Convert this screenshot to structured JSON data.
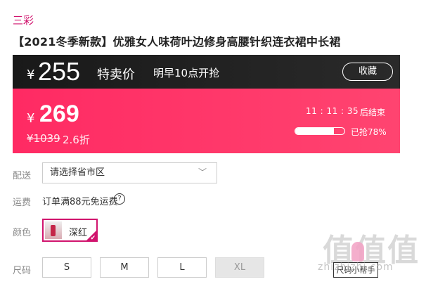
{
  "brand": "三彩",
  "product": {
    "title": "【2021冬季新款】优雅女人味荷叶边修身高腰针织连衣裙中长裙"
  },
  "promo": {
    "currency": "¥",
    "price": "255",
    "label": "特卖价",
    "start_text": "明早10点开抢",
    "favorite_label": "收藏"
  },
  "current": {
    "currency": "¥",
    "price": "269",
    "original": "¥1039",
    "discount": "2.6折",
    "countdown": "11 : 11 : 35",
    "countdown_suffix": "后结束",
    "sold_progress": 0.78,
    "sold_text": "已抢78%"
  },
  "delivery": {
    "label": "配送",
    "placeholder": "请选择省市区"
  },
  "freight": {
    "label": "运费",
    "text": "订单满88元免运费",
    "help_icon": "question-circle-icon"
  },
  "color": {
    "label": "颜色",
    "selected": "深红"
  },
  "size": {
    "label": "尺码",
    "options": [
      {
        "label": "S",
        "available": true
      },
      {
        "label": "M",
        "available": true
      },
      {
        "label": "L",
        "available": true
      },
      {
        "label": "XL",
        "available": false
      }
    ],
    "chart_button": "尺码小帮手"
  },
  "watermark": {
    "text": "值值值",
    "url": "zhizhizhi.com"
  },
  "colors": {
    "accent": "#d1146e",
    "promo_bg": "#1e1e1e",
    "price_bg": "#ff2a63"
  }
}
